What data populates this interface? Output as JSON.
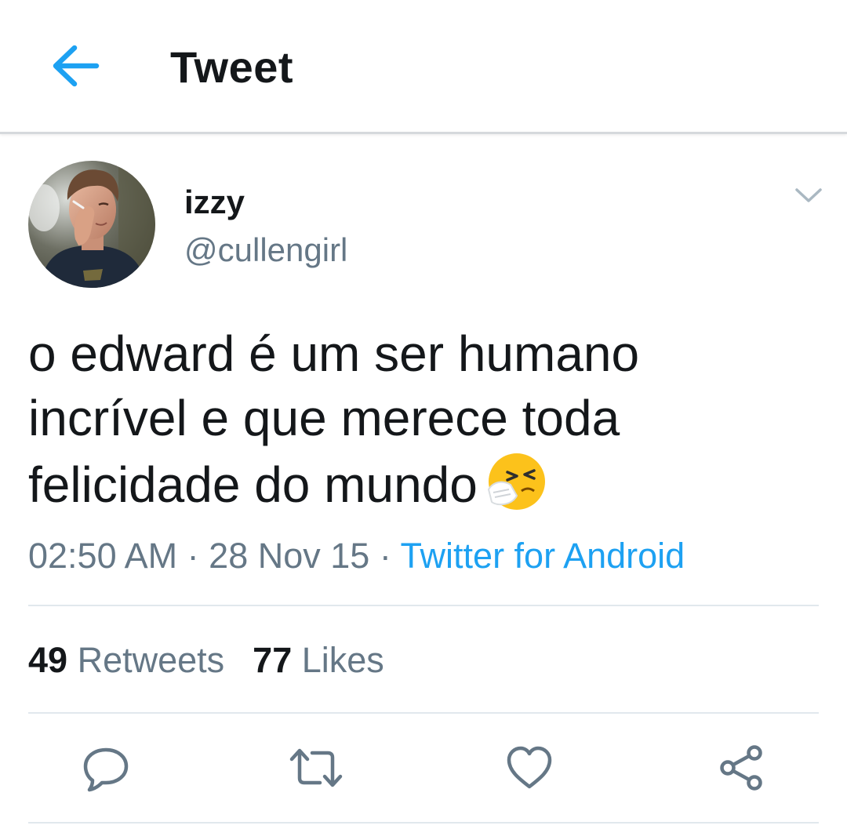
{
  "header": {
    "title": "Tweet",
    "back_icon": "arrow-left-icon"
  },
  "author": {
    "name": "izzy",
    "handle": "@cullengirl",
    "menu_icon": "chevron-down-icon"
  },
  "tweet": {
    "lines": [
      "o edward é um ser humano",
      "incrível e que merece toda",
      "felicidade do mundo"
    ],
    "emoji": "sneezing-face-emoji",
    "time": "02:50 AM",
    "date": "28 Nov 15",
    "separator": "·",
    "source": "Twitter for Android"
  },
  "stats": {
    "retweets_count": "49",
    "retweets_label": "Retweets",
    "likes_count": "77",
    "likes_label": "Likes"
  },
  "actions": [
    "reply-icon",
    "retweet-icon",
    "like-icon",
    "share-icon"
  ],
  "colors": {
    "accent": "#1da1f2",
    "text": "#14171a",
    "secondary": "#657786",
    "divider": "#e1e8ed"
  }
}
